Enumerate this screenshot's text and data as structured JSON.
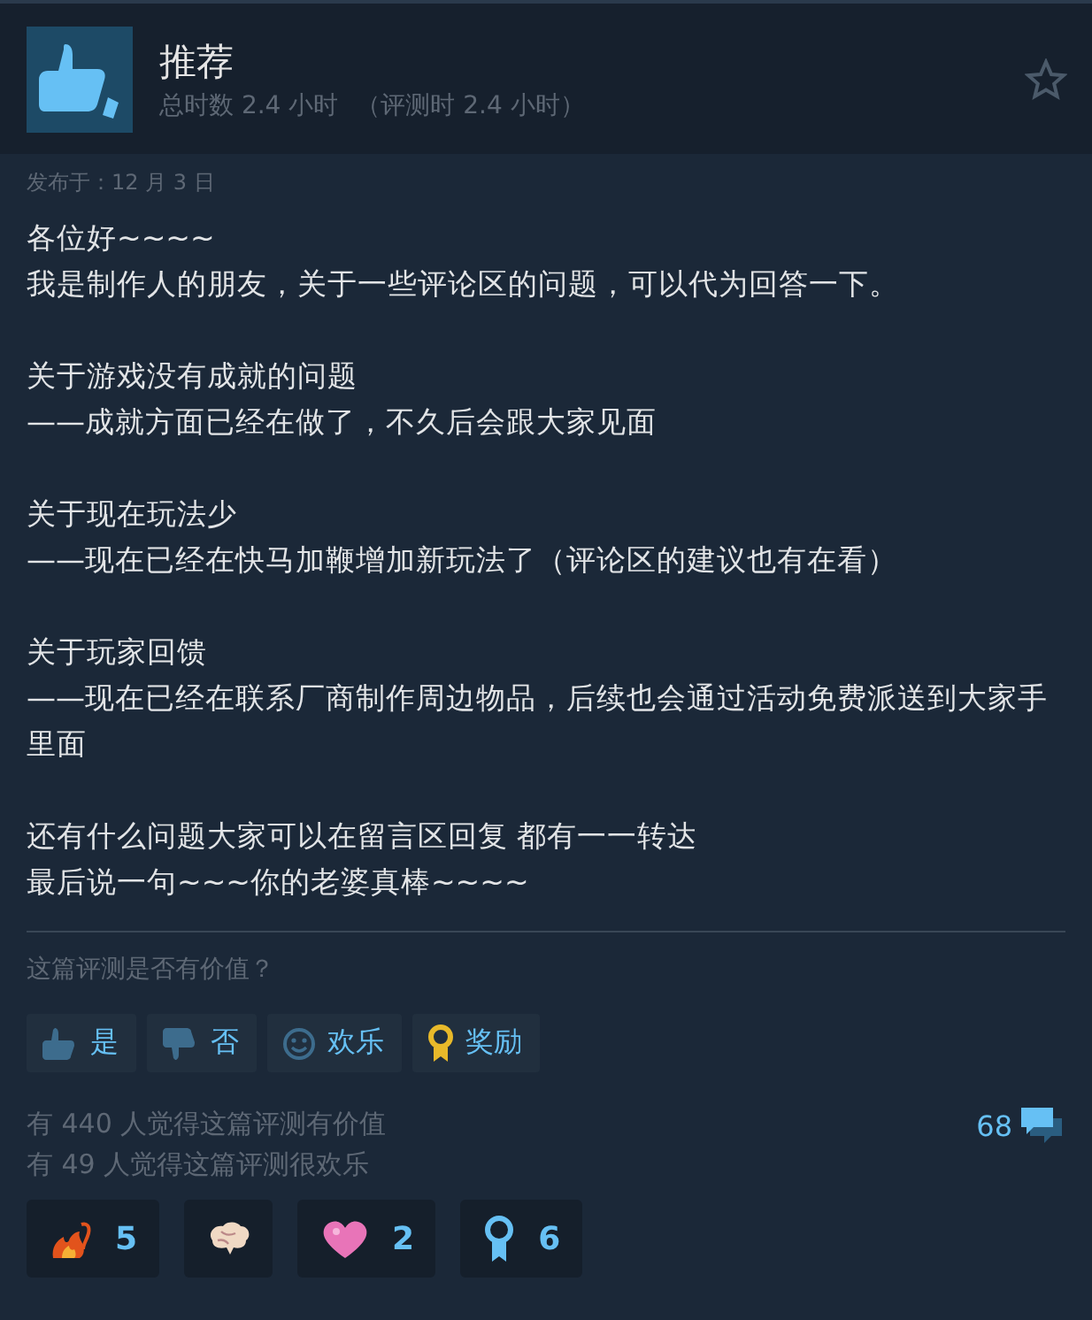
{
  "header": {
    "title": "推荐",
    "hours": "总时数 2.4 小时",
    "review_hours": "（评测时 2.4 小时）"
  },
  "posted": "发布于：12 月 3 日",
  "paragraphs": [
    [
      "各位好~~~~",
      "我是制作人的朋友，关于一些评论区的问题，可以代为回答一下。"
    ],
    [
      "关于游戏没有成就的问题",
      "——成就方面已经在做了，不久后会跟大家见面"
    ],
    [
      "关于现在玩法少",
      "——现在已经在快马加鞭增加新玩法了（评论区的建议也有在看）"
    ],
    [
      "关于玩家回馈",
      "——现在已经在联系厂商制作周边物品，后续也会通过活动免费派送到大家手里面"
    ],
    [
      "还有什么问题大家可以在留言区回复 都有一一转达",
      "最后说一句~~~你的老婆真棒~~~~"
    ]
  ],
  "question": "这篇评测是否有价值？",
  "buttons": [
    {
      "kind": "thumbs-up",
      "label": "是"
    },
    {
      "kind": "thumbs-down",
      "label": "否"
    },
    {
      "kind": "smile",
      "label": "欢乐"
    },
    {
      "kind": "award",
      "label": "奖励"
    }
  ],
  "stats": [
    "有 440 人觉得这篇评测有价值",
    "有 49 人觉得这篇评测很欢乐"
  ],
  "comments": "68",
  "awards": [
    {
      "kind": "fire",
      "count": "5"
    },
    {
      "kind": "brain"
    },
    {
      "kind": "heart",
      "count": "2"
    },
    {
      "kind": "ribbon",
      "count": "6"
    }
  ]
}
